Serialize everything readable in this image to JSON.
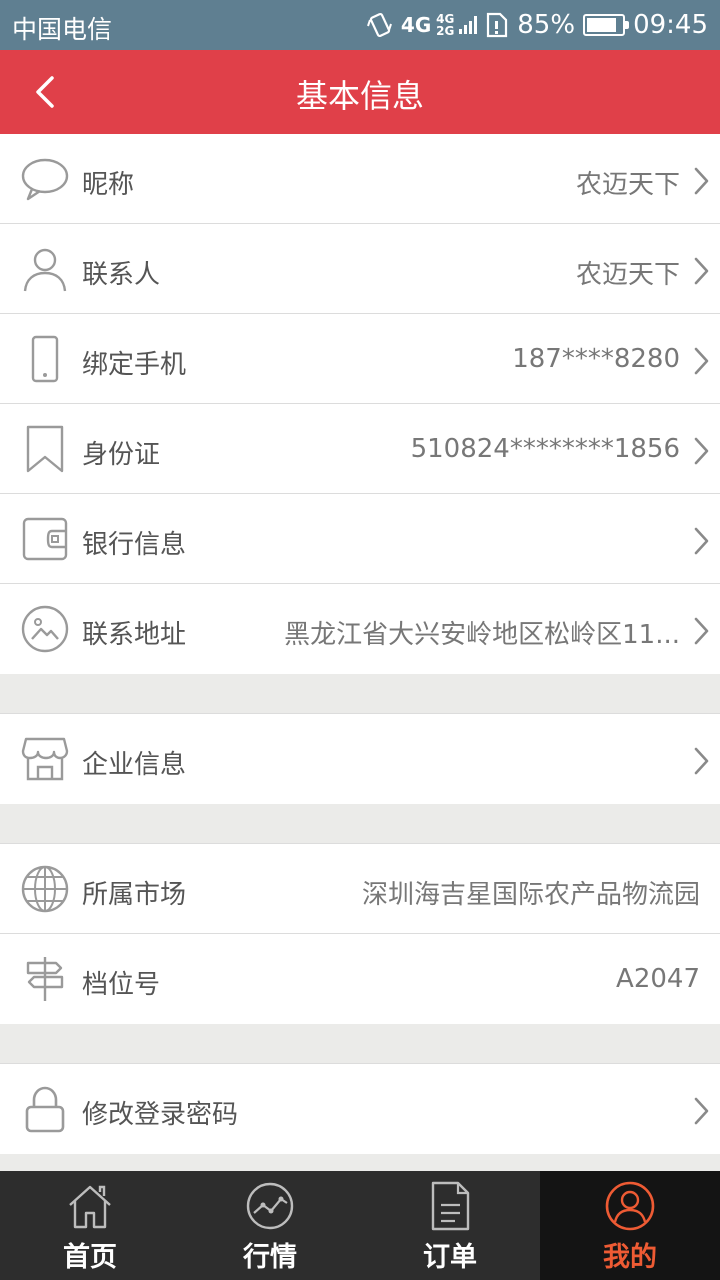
{
  "status_bar": {
    "carrier": "中国电信",
    "network_primary": "4G",
    "network_secondary": "4G 2G",
    "battery_level": 0.85,
    "battery": "85%",
    "time": "09:45"
  },
  "header": {
    "title": "基本信息",
    "back_icon": "chevron-left-icon",
    "background": "#e04049"
  },
  "groups": [
    {
      "rows": [
        {
          "icon": "chat-bubble-icon",
          "label": "昵称",
          "value": "农迈天下",
          "arrow": true
        },
        {
          "icon": "person-icon",
          "label": "联系人",
          "value": "农迈天下",
          "arrow": true
        },
        {
          "icon": "phone-icon",
          "label": "绑定手机",
          "value": "187****8280",
          "arrow": true
        },
        {
          "icon": "bookmark-icon",
          "label": "身份证",
          "value": "510824********1856",
          "arrow": true
        },
        {
          "icon": "wallet-icon",
          "label": "银行信息",
          "value": "",
          "arrow": true
        },
        {
          "icon": "location-photo-icon",
          "label": "联系地址",
          "value": "黑龙江省大兴安岭地区松岭区11...",
          "arrow": true
        }
      ]
    },
    {
      "rows": [
        {
          "icon": "shop-icon",
          "label": "企业信息",
          "value": "",
          "arrow": true
        }
      ]
    },
    {
      "rows": [
        {
          "icon": "globe-icon",
          "label": "所属市场",
          "value": "深圳海吉星国际农产品物流园",
          "arrow": false
        },
        {
          "icon": "signpost-icon",
          "label": "档位号",
          "value": "A2047",
          "arrow": false
        }
      ]
    },
    {
      "rows": [
        {
          "icon": "lock-icon",
          "label": "修改登录密码",
          "value": "",
          "arrow": true
        }
      ]
    }
  ],
  "tabbar": {
    "active_color": "#ee5b34",
    "tabs": [
      {
        "icon": "home-icon",
        "label": "首页",
        "active": false
      },
      {
        "icon": "trend-chart-icon",
        "label": "行情",
        "active": false
      },
      {
        "icon": "document-icon",
        "label": "订单",
        "active": false
      },
      {
        "icon": "user-circle-icon",
        "label": "我的",
        "active": true
      }
    ]
  }
}
